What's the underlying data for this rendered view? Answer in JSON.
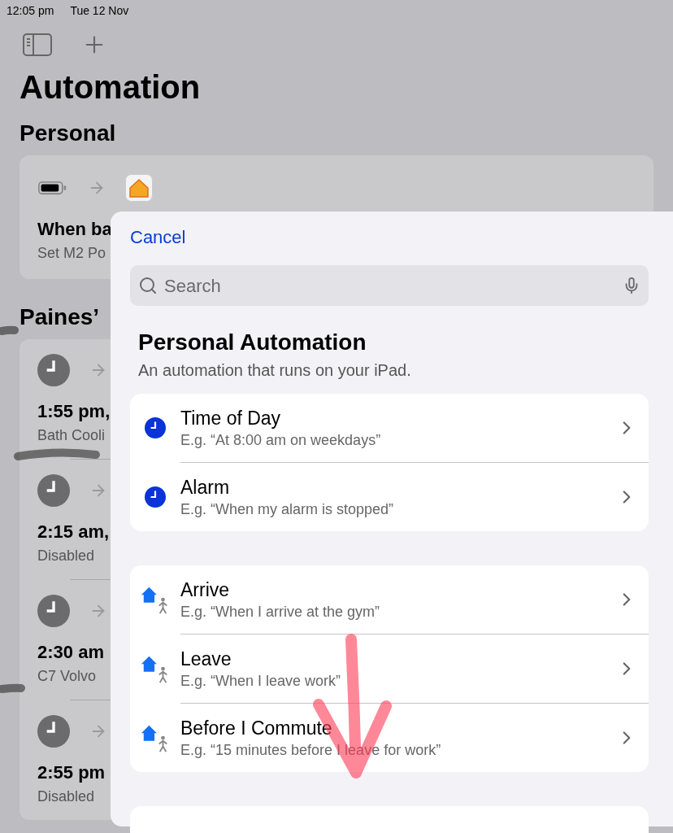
{
  "status_bar": {
    "time": "12:05 pm",
    "date": "Tue 12 Nov"
  },
  "title": "Automation",
  "sections": [
    {
      "heading": "Personal",
      "items": [
        {
          "kind": "battery",
          "title": "When ba",
          "subtitle": "Set M2 Po"
        }
      ]
    },
    {
      "heading": "Paines’",
      "items": [
        {
          "kind": "clock",
          "title": "1:55 pm,",
          "subtitle": "Bath Cooli"
        },
        {
          "kind": "clock",
          "title": "2:15 am,",
          "subtitle": "Disabled"
        },
        {
          "kind": "clock",
          "title": "2:30 am",
          "subtitle": "C7 Volvo"
        },
        {
          "kind": "clock",
          "title": "2:55 pm",
          "subtitle": "Disabled"
        }
      ]
    }
  ],
  "sheet": {
    "cancel": "Cancel",
    "search": {
      "placeholder": "Search"
    },
    "heading": "Personal Automation",
    "subtitle": "An automation that runs on your iPad.",
    "groups": [
      {
        "items": [
          {
            "kind": "clock",
            "title": "Time of Day",
            "example": "E.g. “At 8:00 am on weekdays”"
          },
          {
            "kind": "clock",
            "title": "Alarm",
            "example": "E.g. “When my alarm is stopped”"
          }
        ]
      },
      {
        "items": [
          {
            "kind": "location",
            "title": "Arrive",
            "example": "E.g. “When I arrive at the gym”"
          },
          {
            "kind": "location",
            "title": "Leave",
            "example": "E.g. “When I leave work”"
          },
          {
            "kind": "location",
            "title": "Before I Commute",
            "example": "E.g. “15 minutes before I leave for work”"
          }
        ]
      }
    ]
  }
}
